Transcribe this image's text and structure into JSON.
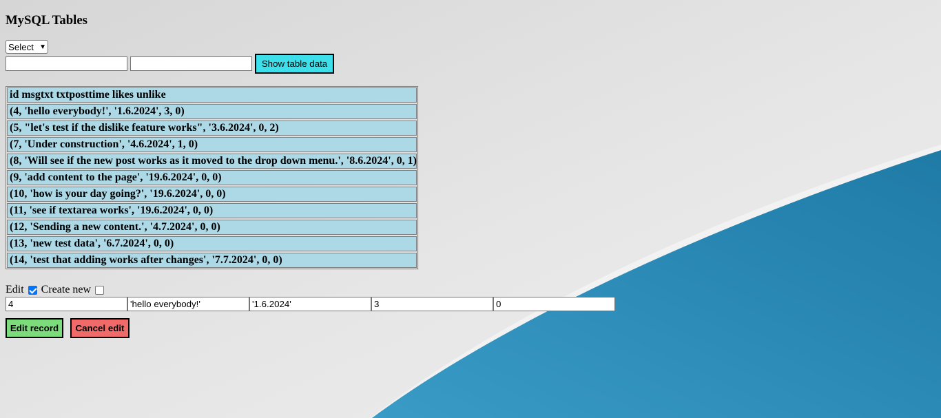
{
  "page": {
    "title": "MySQL Tables"
  },
  "colors": {
    "show_button": "#3de0ea",
    "edit_button": "#7cdc7c",
    "cancel_button": "#f06a6a",
    "table_row": "#add8e6",
    "background_grey": "#e3e3e3",
    "background_blue": "#2b86b3"
  },
  "controls": {
    "select_value": "Select",
    "input1_value": "",
    "input2_value": "",
    "show_button_label": "Show table data"
  },
  "table": {
    "header": "id msgtxt txtposttime likes unlike",
    "rows": [
      "(4, 'hello everybody!', '1.6.2024', 3, 0)",
      "(5, \"let's test if the dislike feature works\", '3.6.2024', 0, 2)",
      "(7, 'Under construction', '4.6.2024', 1, 0)",
      "(8, 'Will see if the new post works as it moved to the drop down menu.', '8.6.2024', 0, 1)",
      "(9, 'add content to the page', '19.6.2024', 0, 0)",
      "(10, 'how is your day going?', '19.6.2024', 0, 0)",
      "(11, 'see if textarea works', '19.6.2024', 0, 0)",
      "(12, 'Sending a new content.', '4.7.2024', 0, 0)",
      "(13, 'new test data', '6.7.2024', 0, 0)",
      "(14, 'test that adding works after changes', '7.7.2024', 0, 0)"
    ]
  },
  "edit": {
    "edit_label": "Edit",
    "edit_checked": true,
    "create_label": "Create new",
    "create_checked": false,
    "fields": [
      "4",
      "'hello everybody!'",
      "'1.6.2024'",
      "3",
      "0"
    ],
    "edit_button_label": "Edit record",
    "cancel_button_label": "Cancel edit"
  }
}
